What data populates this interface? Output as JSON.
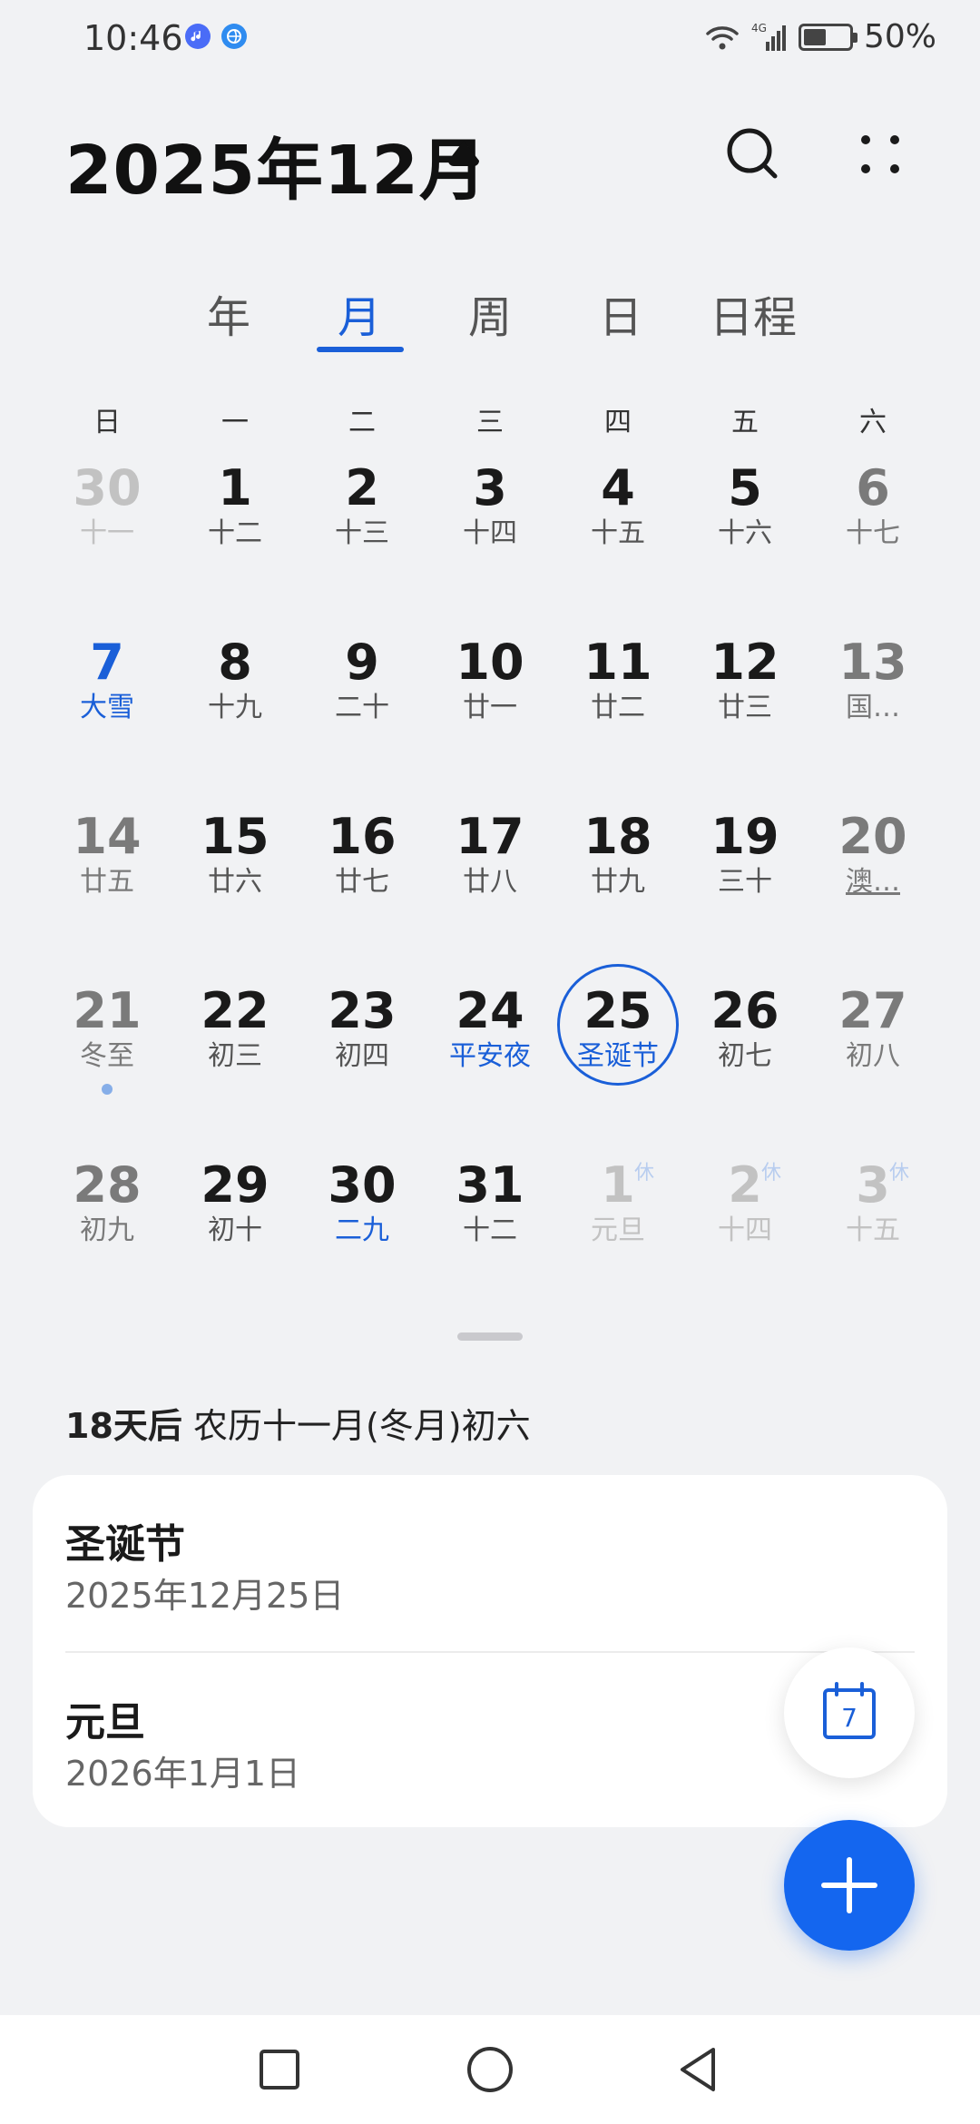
{
  "status_bar": {
    "time": "10:46",
    "battery_text": "50%",
    "battery_level": 0.5,
    "network": "4G",
    "icons": [
      "music-app-icon",
      "browser-app-icon",
      "wifi-icon",
      "signal-icon",
      "battery-icon"
    ]
  },
  "header": {
    "title": "2025年12月",
    "icons": [
      "caret-up-icon",
      "search-icon",
      "more-icon"
    ]
  },
  "tabs": [
    {
      "label": "年",
      "active": false
    },
    {
      "label": "月",
      "active": true
    },
    {
      "label": "周",
      "active": false
    },
    {
      "label": "日",
      "active": false
    },
    {
      "label": "日程",
      "active": false
    }
  ],
  "weekdays": [
    "日",
    "一",
    "二",
    "三",
    "四",
    "五",
    "六"
  ],
  "calendar": {
    "rows": [
      [
        {
          "day": "30",
          "sub": "十一"
        },
        {
          "day": "1",
          "sub": "十二"
        },
        {
          "day": "2",
          "sub": "十三"
        },
        {
          "day": "3",
          "sub": "十四"
        },
        {
          "day": "4",
          "sub": "十五"
        },
        {
          "day": "5",
          "sub": "十六"
        },
        {
          "day": "6",
          "sub": "十七"
        }
      ],
      [
        {
          "day": "7",
          "sub": "大雪"
        },
        {
          "day": "8",
          "sub": "十九"
        },
        {
          "day": "9",
          "sub": "二十"
        },
        {
          "day": "10",
          "sub": "廿一"
        },
        {
          "day": "11",
          "sub": "廿二"
        },
        {
          "day": "12",
          "sub": "廿三"
        },
        {
          "day": "13",
          "sub": "国…"
        }
      ],
      [
        {
          "day": "14",
          "sub": "廿五"
        },
        {
          "day": "15",
          "sub": "廿六"
        },
        {
          "day": "16",
          "sub": "廿七"
        },
        {
          "day": "17",
          "sub": "廿八"
        },
        {
          "day": "18",
          "sub": "廿九"
        },
        {
          "day": "19",
          "sub": "三十"
        },
        {
          "day": "20",
          "sub": "澳…"
        }
      ],
      [
        {
          "day": "21",
          "sub": "冬至"
        },
        {
          "day": "22",
          "sub": "初三"
        },
        {
          "day": "23",
          "sub": "初四"
        },
        {
          "day": "24",
          "sub": "平安夜"
        },
        {
          "day": "25",
          "sub": "圣诞节"
        },
        {
          "day": "26",
          "sub": "初七"
        },
        {
          "day": "27",
          "sub": "初八"
        }
      ],
      [
        {
          "day": "28",
          "sub": "初九"
        },
        {
          "day": "29",
          "sub": "初十"
        },
        {
          "day": "30",
          "sub": "二九"
        },
        {
          "day": "31",
          "sub": "十二"
        },
        {
          "day": "1",
          "sub": "元旦",
          "badge": "休"
        },
        {
          "day": "2",
          "sub": "十四",
          "badge": "休"
        },
        {
          "day": "3",
          "sub": "十五",
          "badge": "休"
        }
      ]
    ]
  },
  "countdown": {
    "days": "18天后",
    "lunar": "农历十一月(冬月)初六"
  },
  "events": [
    {
      "title": "圣诞节",
      "date": "2025年12月25日"
    },
    {
      "title": "元旦",
      "date": "2026年1月1日"
    }
  ],
  "fab": {
    "today_day": "7",
    "icons": [
      "calendar-today-icon",
      "plus-icon"
    ]
  },
  "colors": {
    "accent": "#1a5fd8",
    "fab": "#1466ef",
    "background": "#f1f2f4"
  },
  "nav_bar": {
    "icons": [
      "recent-apps-icon",
      "home-icon",
      "back-icon"
    ]
  }
}
